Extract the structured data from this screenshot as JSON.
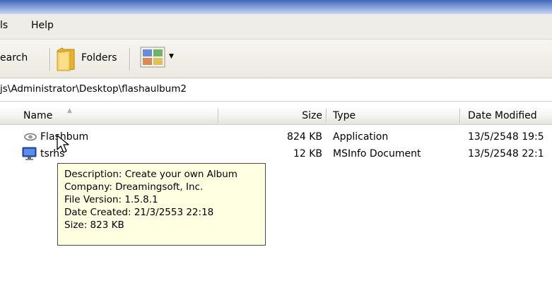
{
  "menu": {
    "items": [
      {
        "label": "ls"
      },
      {
        "label": "Help"
      }
    ]
  },
  "toolbar": {
    "search_label": "earch",
    "folders_label": "Folders",
    "views_icon": "views-icon",
    "folder_icon": "folder-icon"
  },
  "address": {
    "path": "js\\Administrator\\Desktop\\flashaulbum2"
  },
  "columns": {
    "name": "Name",
    "size": "Size",
    "type": "Type",
    "date_modified": "Date Modified"
  },
  "files": [
    {
      "name": "Flashbum",
      "size": "824 KB",
      "type": "Application",
      "date_modified": "13/5/2548 19:5",
      "icon": "flash-app-icon"
    },
    {
      "name": "tsrhs",
      "size": "12 KB",
      "type": "MSInfo Document",
      "date_modified": "13/5/2548 22:1",
      "icon": "msinfo-document-icon"
    }
  ],
  "tooltip": {
    "description": "Description: Create your own Album",
    "company": "Company: Dreamingsoft, Inc.",
    "file_version": "File Version: 1.5.8.1",
    "date_created": "Date Created: 21/3/2553 22:18",
    "size": "Size: 823 KB"
  },
  "colors": {
    "tooltip_bg": "#ffffe1",
    "menubar_bg": "#eeede7",
    "title_blue": "#3e66b3"
  }
}
